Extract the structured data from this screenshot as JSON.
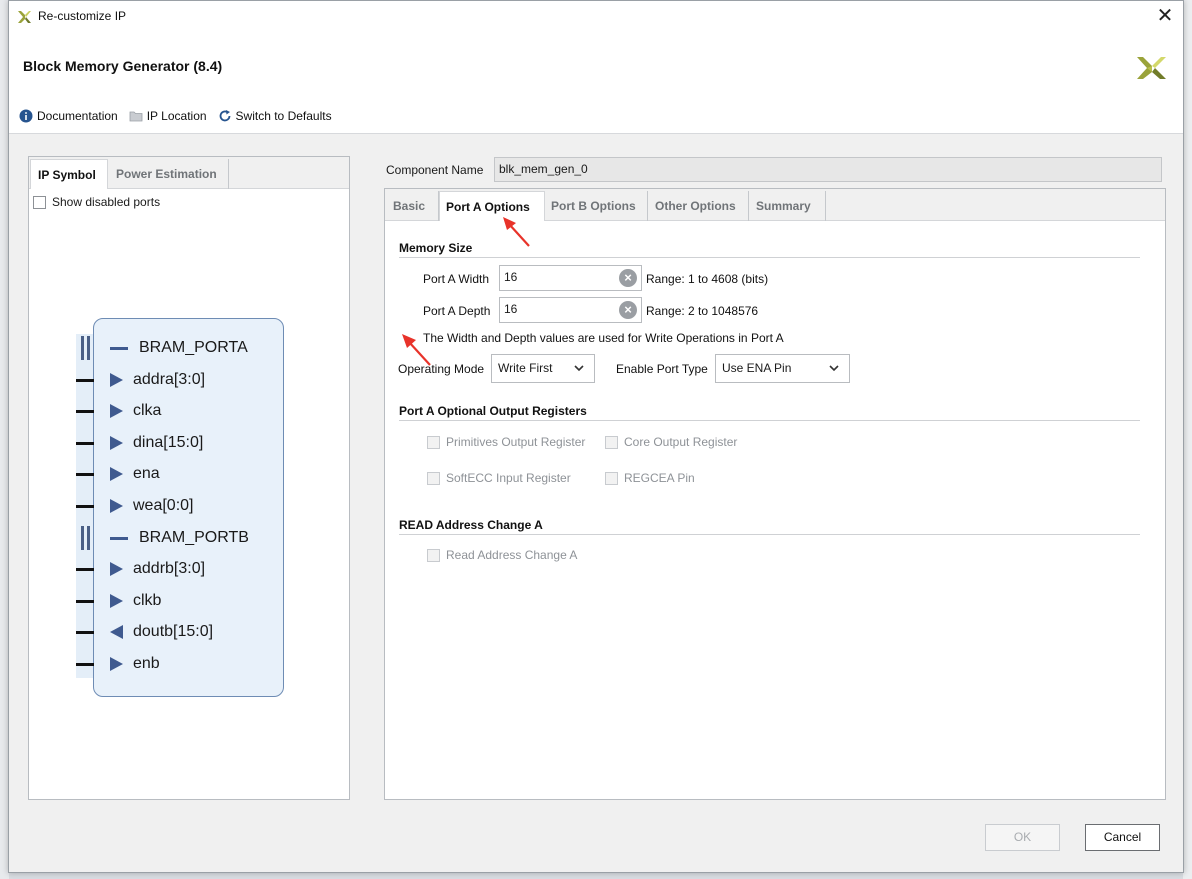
{
  "window": {
    "title": "Re-customize IP"
  },
  "header": {
    "heading": "Block Memory Generator (8.4)",
    "toolbar": [
      {
        "label": "Documentation",
        "icon": "info-icon"
      },
      {
        "label": "IP Location",
        "icon": "folder-icon"
      },
      {
        "label": "Switch to Defaults",
        "icon": "refresh-icon"
      }
    ]
  },
  "left_panel": {
    "tabs": [
      "IP Symbol",
      "Power Estimation"
    ],
    "active_tab": "IP Symbol",
    "show_disabled_ports_label": "Show disabled ports",
    "ports": [
      {
        "label": "BRAM_PORTA",
        "kind": "bus"
      },
      {
        "label": "addra[3:0]",
        "kind": "in"
      },
      {
        "label": "clka",
        "kind": "in"
      },
      {
        "label": "dina[15:0]",
        "kind": "in"
      },
      {
        "label": "ena",
        "kind": "in"
      },
      {
        "label": "wea[0:0]",
        "kind": "in"
      },
      {
        "label": "BRAM_PORTB",
        "kind": "bus"
      },
      {
        "label": "addrb[3:0]",
        "kind": "in"
      },
      {
        "label": "clkb",
        "kind": "in"
      },
      {
        "label": "doutb[15:0]",
        "kind": "out"
      },
      {
        "label": "enb",
        "kind": "in"
      }
    ]
  },
  "component": {
    "label": "Component Name",
    "value": "blk_mem_gen_0"
  },
  "right_panel": {
    "tabs": [
      "Basic",
      "Port A Options",
      "Port B Options",
      "Other Options",
      "Summary"
    ],
    "active_tab": "Port A Options",
    "memory_size": {
      "title": "Memory Size",
      "width_label": "Port A Width",
      "width_value": "16",
      "width_range": "Range: 1 to 4608 (bits)",
      "depth_label": "Port A Depth",
      "depth_value": "16",
      "depth_range": "Range: 2 to 1048576",
      "note": "The Width and Depth values are used for Write Operations in Port A",
      "operating_mode_label": "Operating Mode",
      "operating_mode_value": "Write First",
      "enable_port_label": "Enable Port Type",
      "enable_port_value": "Use ENA Pin"
    },
    "optional_registers": {
      "title": "Port A Optional Output Registers",
      "primitives": "Primitives Output Register",
      "core": "Core Output Register",
      "softecc": "SoftECC Input Register",
      "regcea": "REGCEA Pin"
    },
    "read_address": {
      "title": "READ Address Change A",
      "option": "Read Address Change A"
    }
  },
  "footer": {
    "ok_label": "OK",
    "cancel_label": "Cancel"
  },
  "colors": {
    "accent": "#3f5a8f",
    "symbol_fill": "#e8f1fa",
    "arrow": "#e8332a"
  }
}
